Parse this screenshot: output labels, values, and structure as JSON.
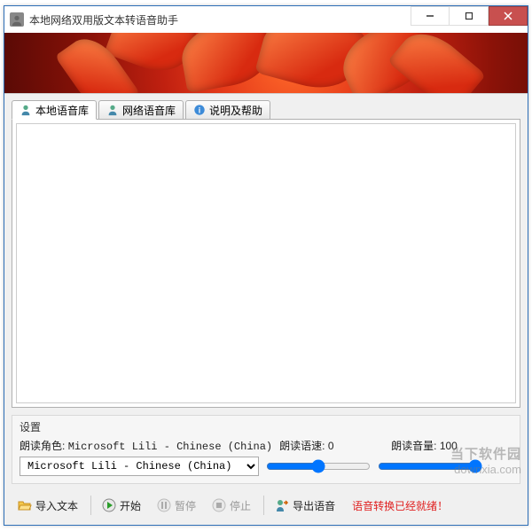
{
  "window": {
    "title": "本地网络双用版文本转语音助手"
  },
  "tabs": [
    {
      "label": "本地语音库",
      "active": true
    },
    {
      "label": "网络语音库",
      "active": false
    },
    {
      "label": "说明及帮助",
      "active": false
    }
  ],
  "textarea": {
    "value": "",
    "placeholder": ""
  },
  "settings": {
    "section_title": "设置",
    "voice_label": "朗读角色:",
    "voice_value_display": "Microsoft Lili - Chinese (China)",
    "voice_selected": "Microsoft Lili - Chinese (China)",
    "speed_label": "朗读语速:",
    "speed_value": "0",
    "volume_label": "朗读音量:",
    "volume_value": "100"
  },
  "toolbar": {
    "import_label": "导入文本",
    "start_label": "开始",
    "pause_label": "暂停",
    "stop_label": "停止",
    "export_label": "导出语音",
    "status": "语音转换已经就绪！"
  },
  "watermark": {
    "line1": "当下软件园",
    "line2": "downxia.com"
  },
  "colors": {
    "close_btn": "#c8504f",
    "status_text": "#e02020",
    "banner_primary": "#d82a10"
  }
}
